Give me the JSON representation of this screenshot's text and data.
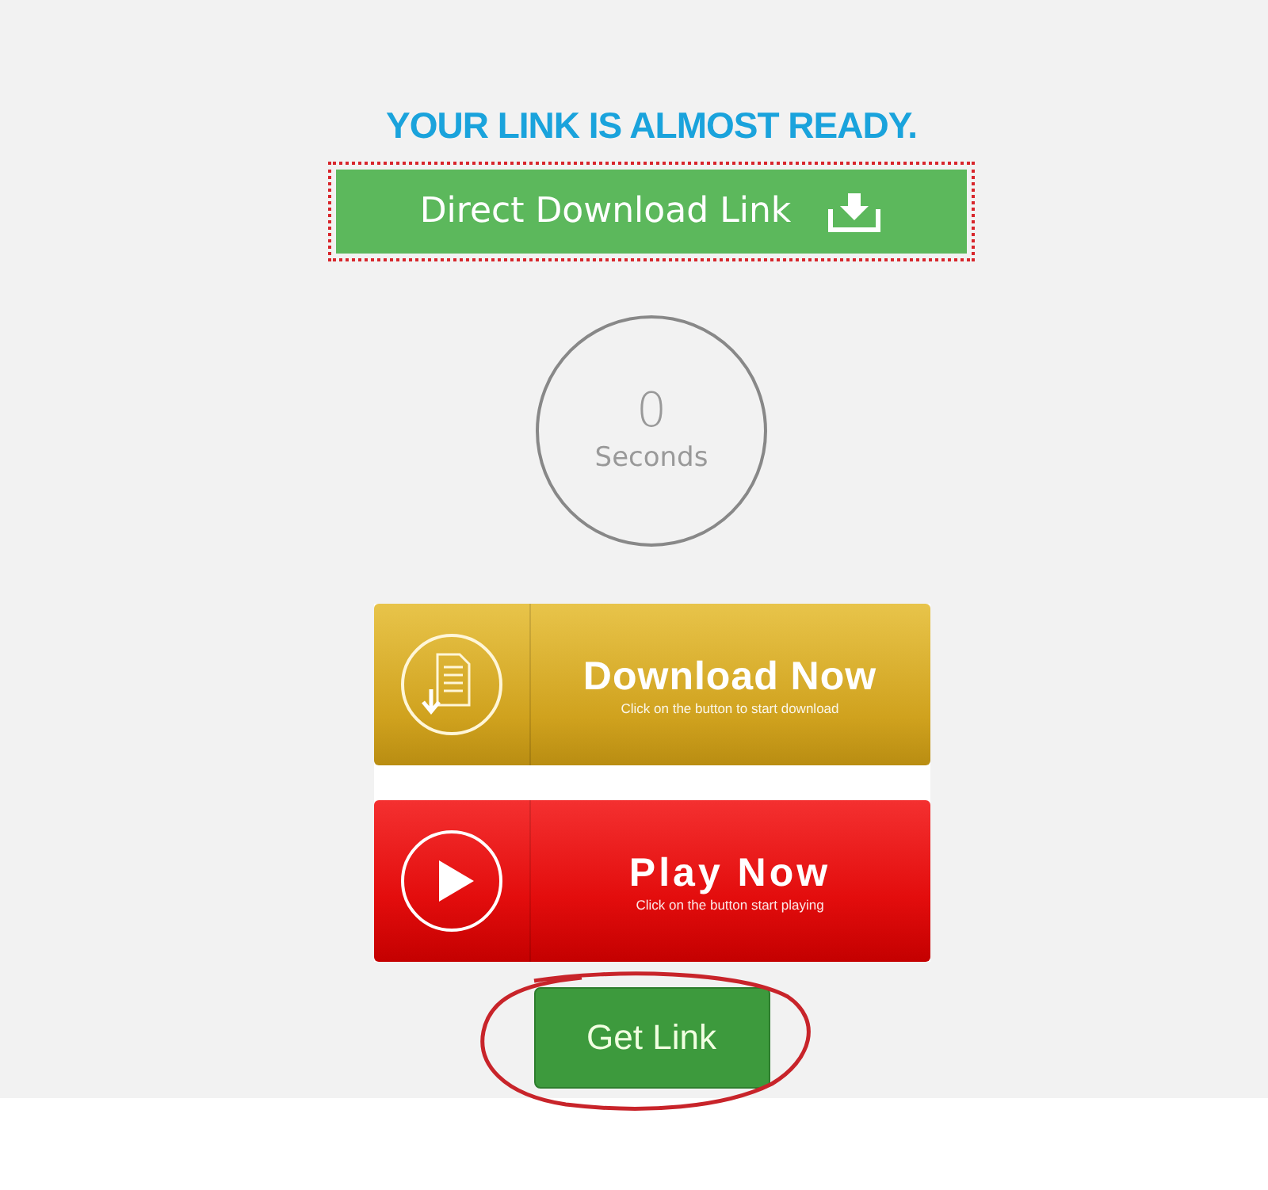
{
  "heading": "YOUR LINK IS ALMOST READY.",
  "direct_link": {
    "label": "Direct Download Link"
  },
  "countdown": {
    "value": "0",
    "unit": "Seconds"
  },
  "action_buttons": [
    {
      "kind": "download",
      "title": "Download Now",
      "subtitle": "Click on the button to start download"
    },
    {
      "kind": "play",
      "title": "Play Now",
      "subtitle": "Click on the button start playing"
    }
  ],
  "get_link": {
    "label": "Get Link",
    "circled": true
  }
}
